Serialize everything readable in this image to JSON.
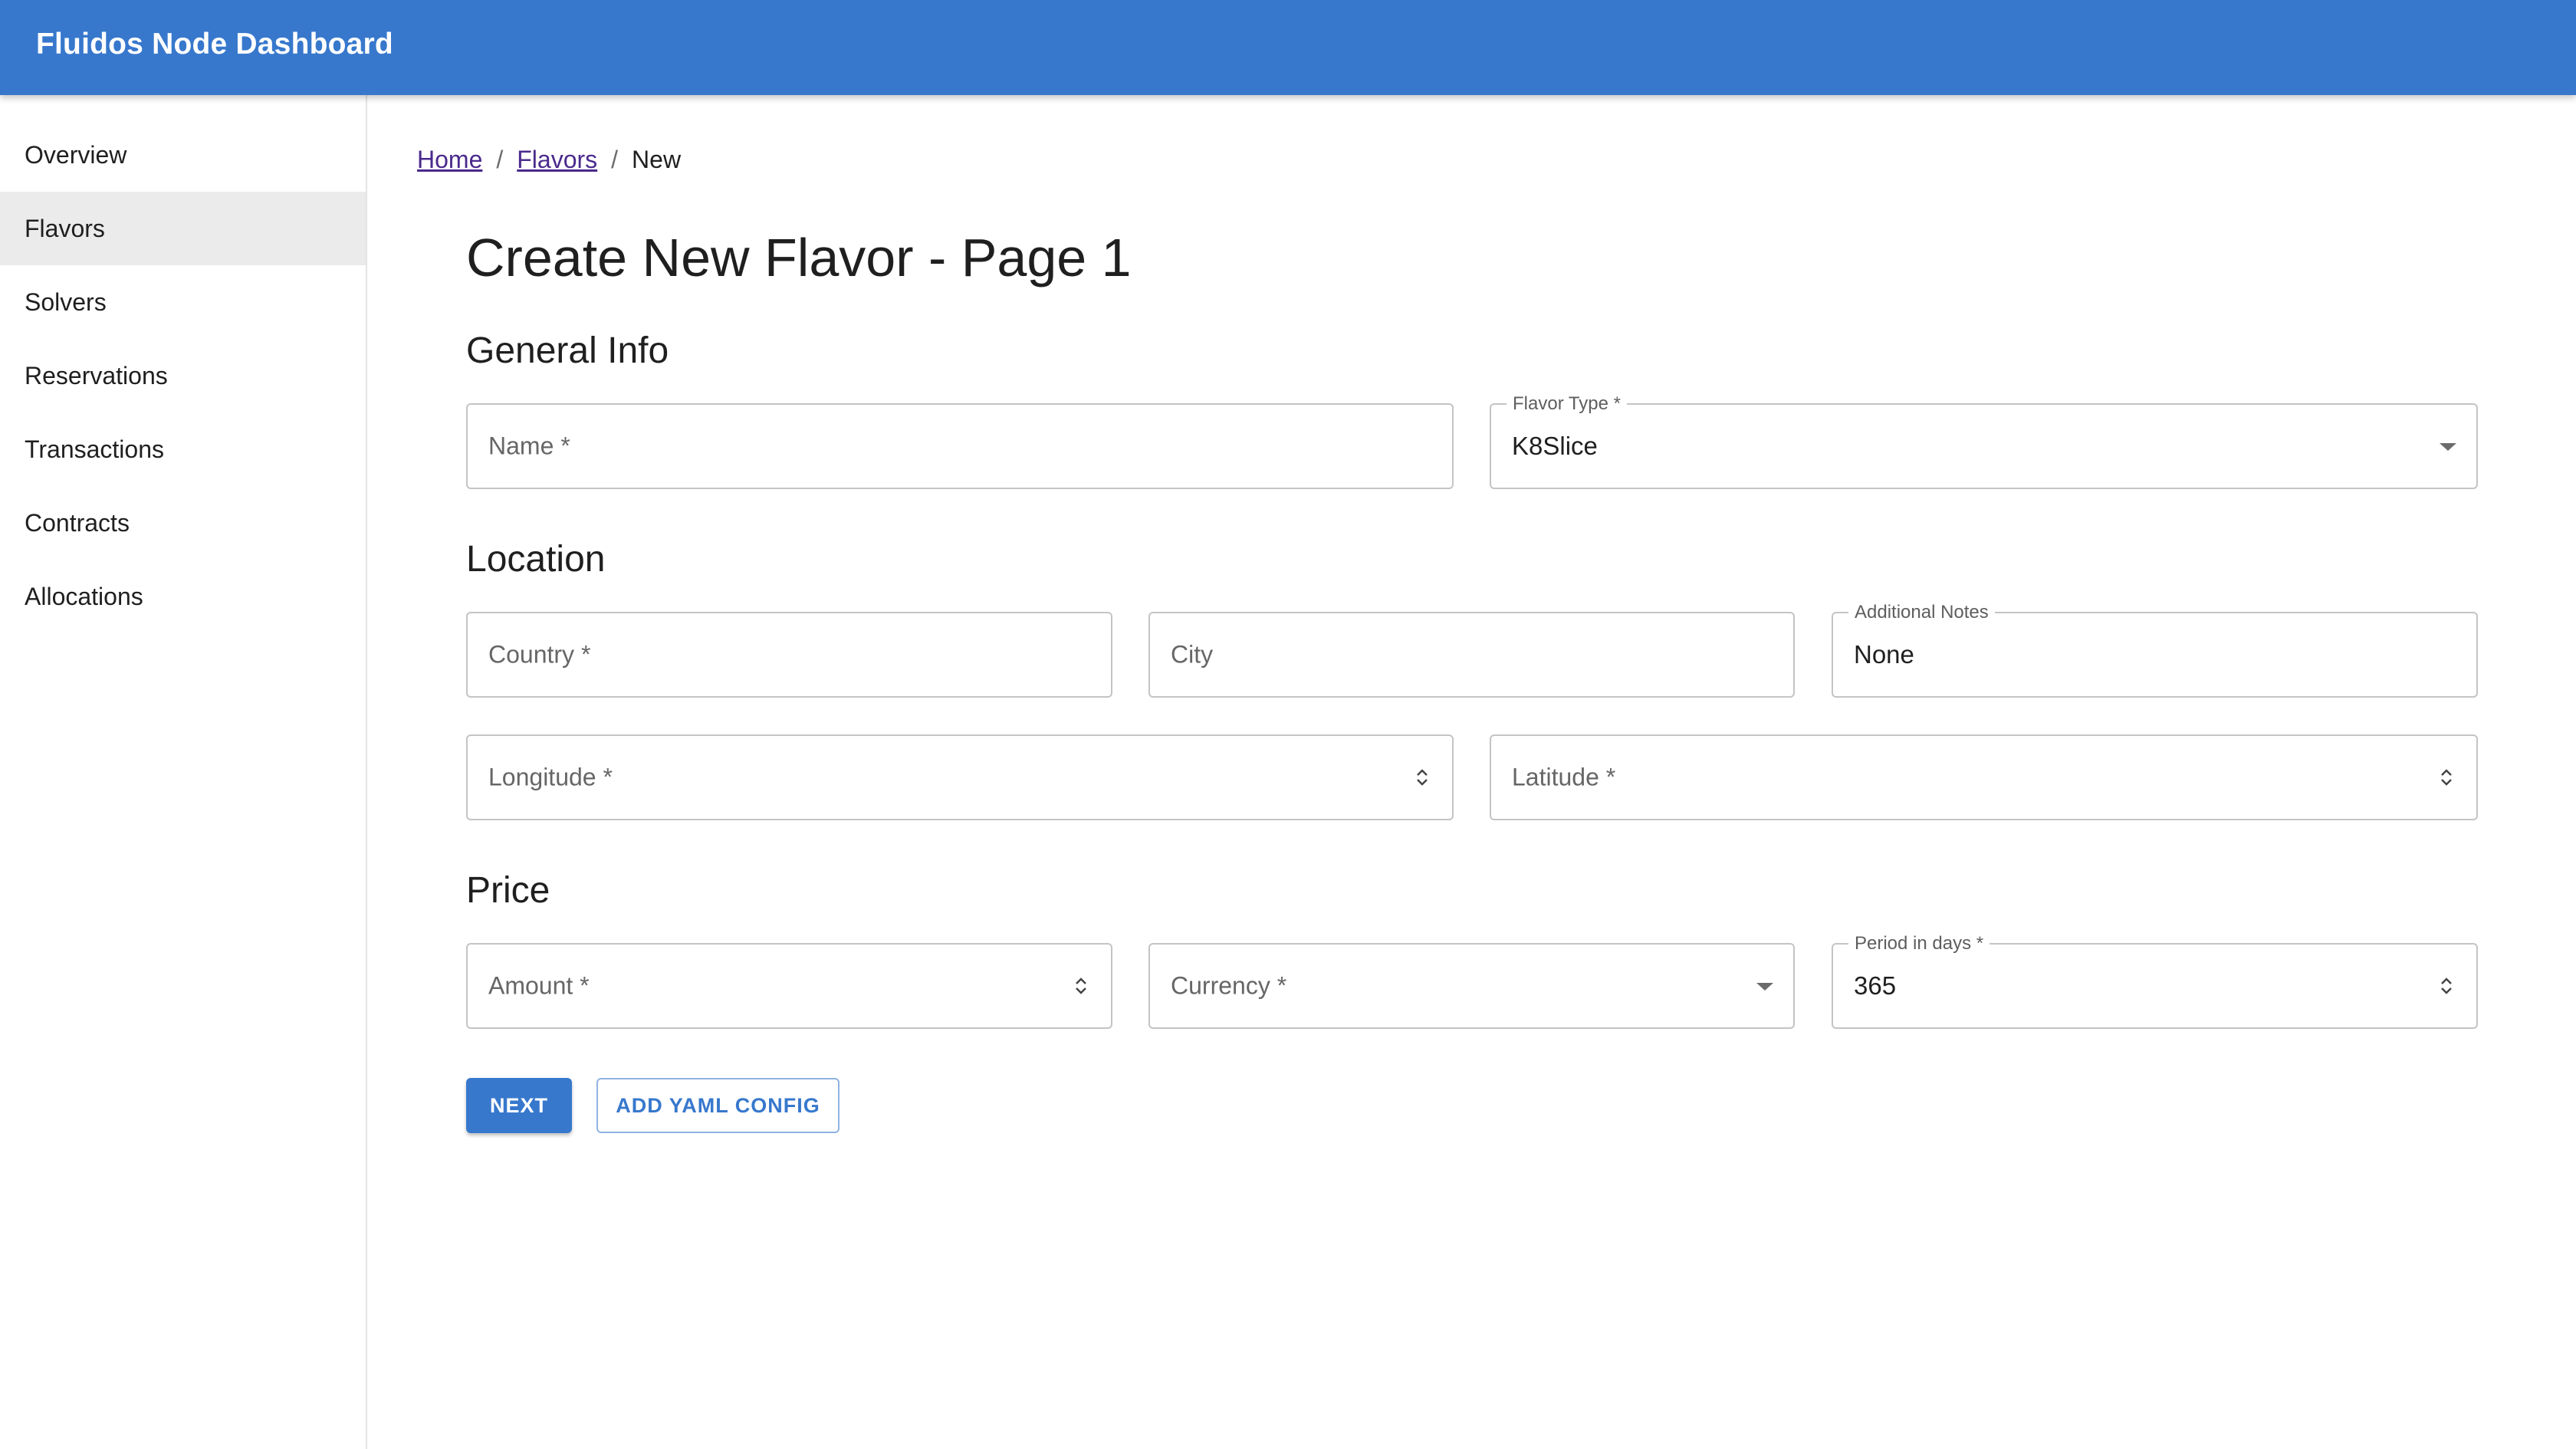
{
  "app": {
    "title": "Fluidos Node Dashboard"
  },
  "sidebar": {
    "items": [
      {
        "label": "Overview",
        "selected": false
      },
      {
        "label": "Flavors",
        "selected": true
      },
      {
        "label": "Solvers",
        "selected": false
      },
      {
        "label": "Reservations",
        "selected": false
      },
      {
        "label": "Transactions",
        "selected": false
      },
      {
        "label": "Contracts",
        "selected": false
      },
      {
        "label": "Allocations",
        "selected": false
      }
    ]
  },
  "breadcrumb": {
    "home": "Home",
    "flavors": "Flavors",
    "current": "New",
    "separator": "/"
  },
  "page": {
    "title": "Create New Flavor - Page 1"
  },
  "sections": {
    "general": "General Info",
    "location": "Location",
    "price": "Price"
  },
  "form": {
    "name": {
      "placeholder": "Name *",
      "value": ""
    },
    "flavor_type": {
      "label": "Flavor Type *",
      "value": "K8Slice"
    },
    "country": {
      "placeholder": "Country *",
      "value": ""
    },
    "city": {
      "placeholder": "City",
      "value": ""
    },
    "additional_notes": {
      "label": "Additional Notes",
      "value": "None"
    },
    "longitude": {
      "placeholder": "Longitude *",
      "value": ""
    },
    "latitude": {
      "placeholder": "Latitude *",
      "value": ""
    },
    "amount": {
      "placeholder": "Amount *",
      "value": ""
    },
    "currency": {
      "placeholder": "Currency *",
      "value": ""
    },
    "period": {
      "label": "Period in days *",
      "value": "365"
    }
  },
  "buttons": {
    "next": "NEXT",
    "add_yaml": "ADD YAML CONFIG"
  },
  "colors": {
    "primary": "#3778cd",
    "selected_nav_bg": "#ebebeb",
    "link": "#4a2a8c"
  },
  "icons": {
    "select_caret": "chevron-down-icon",
    "number_spinner": "spinner-icon"
  }
}
